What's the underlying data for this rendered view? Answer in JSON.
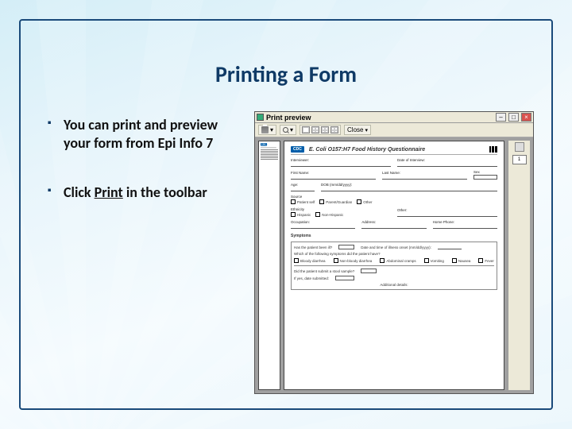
{
  "slide": {
    "title": "Printing a Form",
    "bullets": [
      {
        "text_a": "You can print and preview your form from Epi Info 7",
        "underline": ""
      },
      {
        "text_a": "Click ",
        "underline": "Print",
        "text_b": " in the toolbar"
      }
    ]
  },
  "preview_window": {
    "title": "Print preview",
    "toolbar": {
      "print_tooltip": "Print",
      "zoom_tooltip": "Zoom",
      "close_label": "Close",
      "page_selector": "1"
    },
    "form": {
      "org": "CDC",
      "title": "E. Coli O157:H7 Food History Questionnaire",
      "sections": {
        "demographics": {
          "label_interviewer": "Interviewer:",
          "label_date": "Date of Interview:",
          "label_firstname": "First Name:",
          "label_lastname": "Last Name:",
          "label_sex": "Sex",
          "label_age": "Age:",
          "label_dob": "DOB (mm/dd/yyyy):",
          "label_source": "Source",
          "src_opts": [
            "Patient self",
            "Parent/Guardian",
            "Other"
          ],
          "label_ethnicity": "Ethnicity",
          "eth_opts": [
            "Hispanic",
            "Non-Hispanic"
          ],
          "label_other": "Other:",
          "label_occupation": "Occupation:",
          "label_address": "Address:",
          "label_phone": "Home Phone:"
        },
        "symptoms": {
          "header": "Symptoms",
          "q_ill": "Has the patient been ill?",
          "q_onset": "Date and time of illness onset (mm/dd/yyyy):",
          "opts": [
            "Bloody diarrhea",
            "Non-bloody diarrhea",
            "Abdominal cramps",
            "Vomiting",
            "Nausea",
            "Fever"
          ],
          "q_which": "Which of the following symptoms did the patient have?",
          "q_stool": "Did the patient submit a stool sample?",
          "q_stool_date": "If yes, date submitted:",
          "footer": "Additional details:"
        }
      }
    }
  }
}
